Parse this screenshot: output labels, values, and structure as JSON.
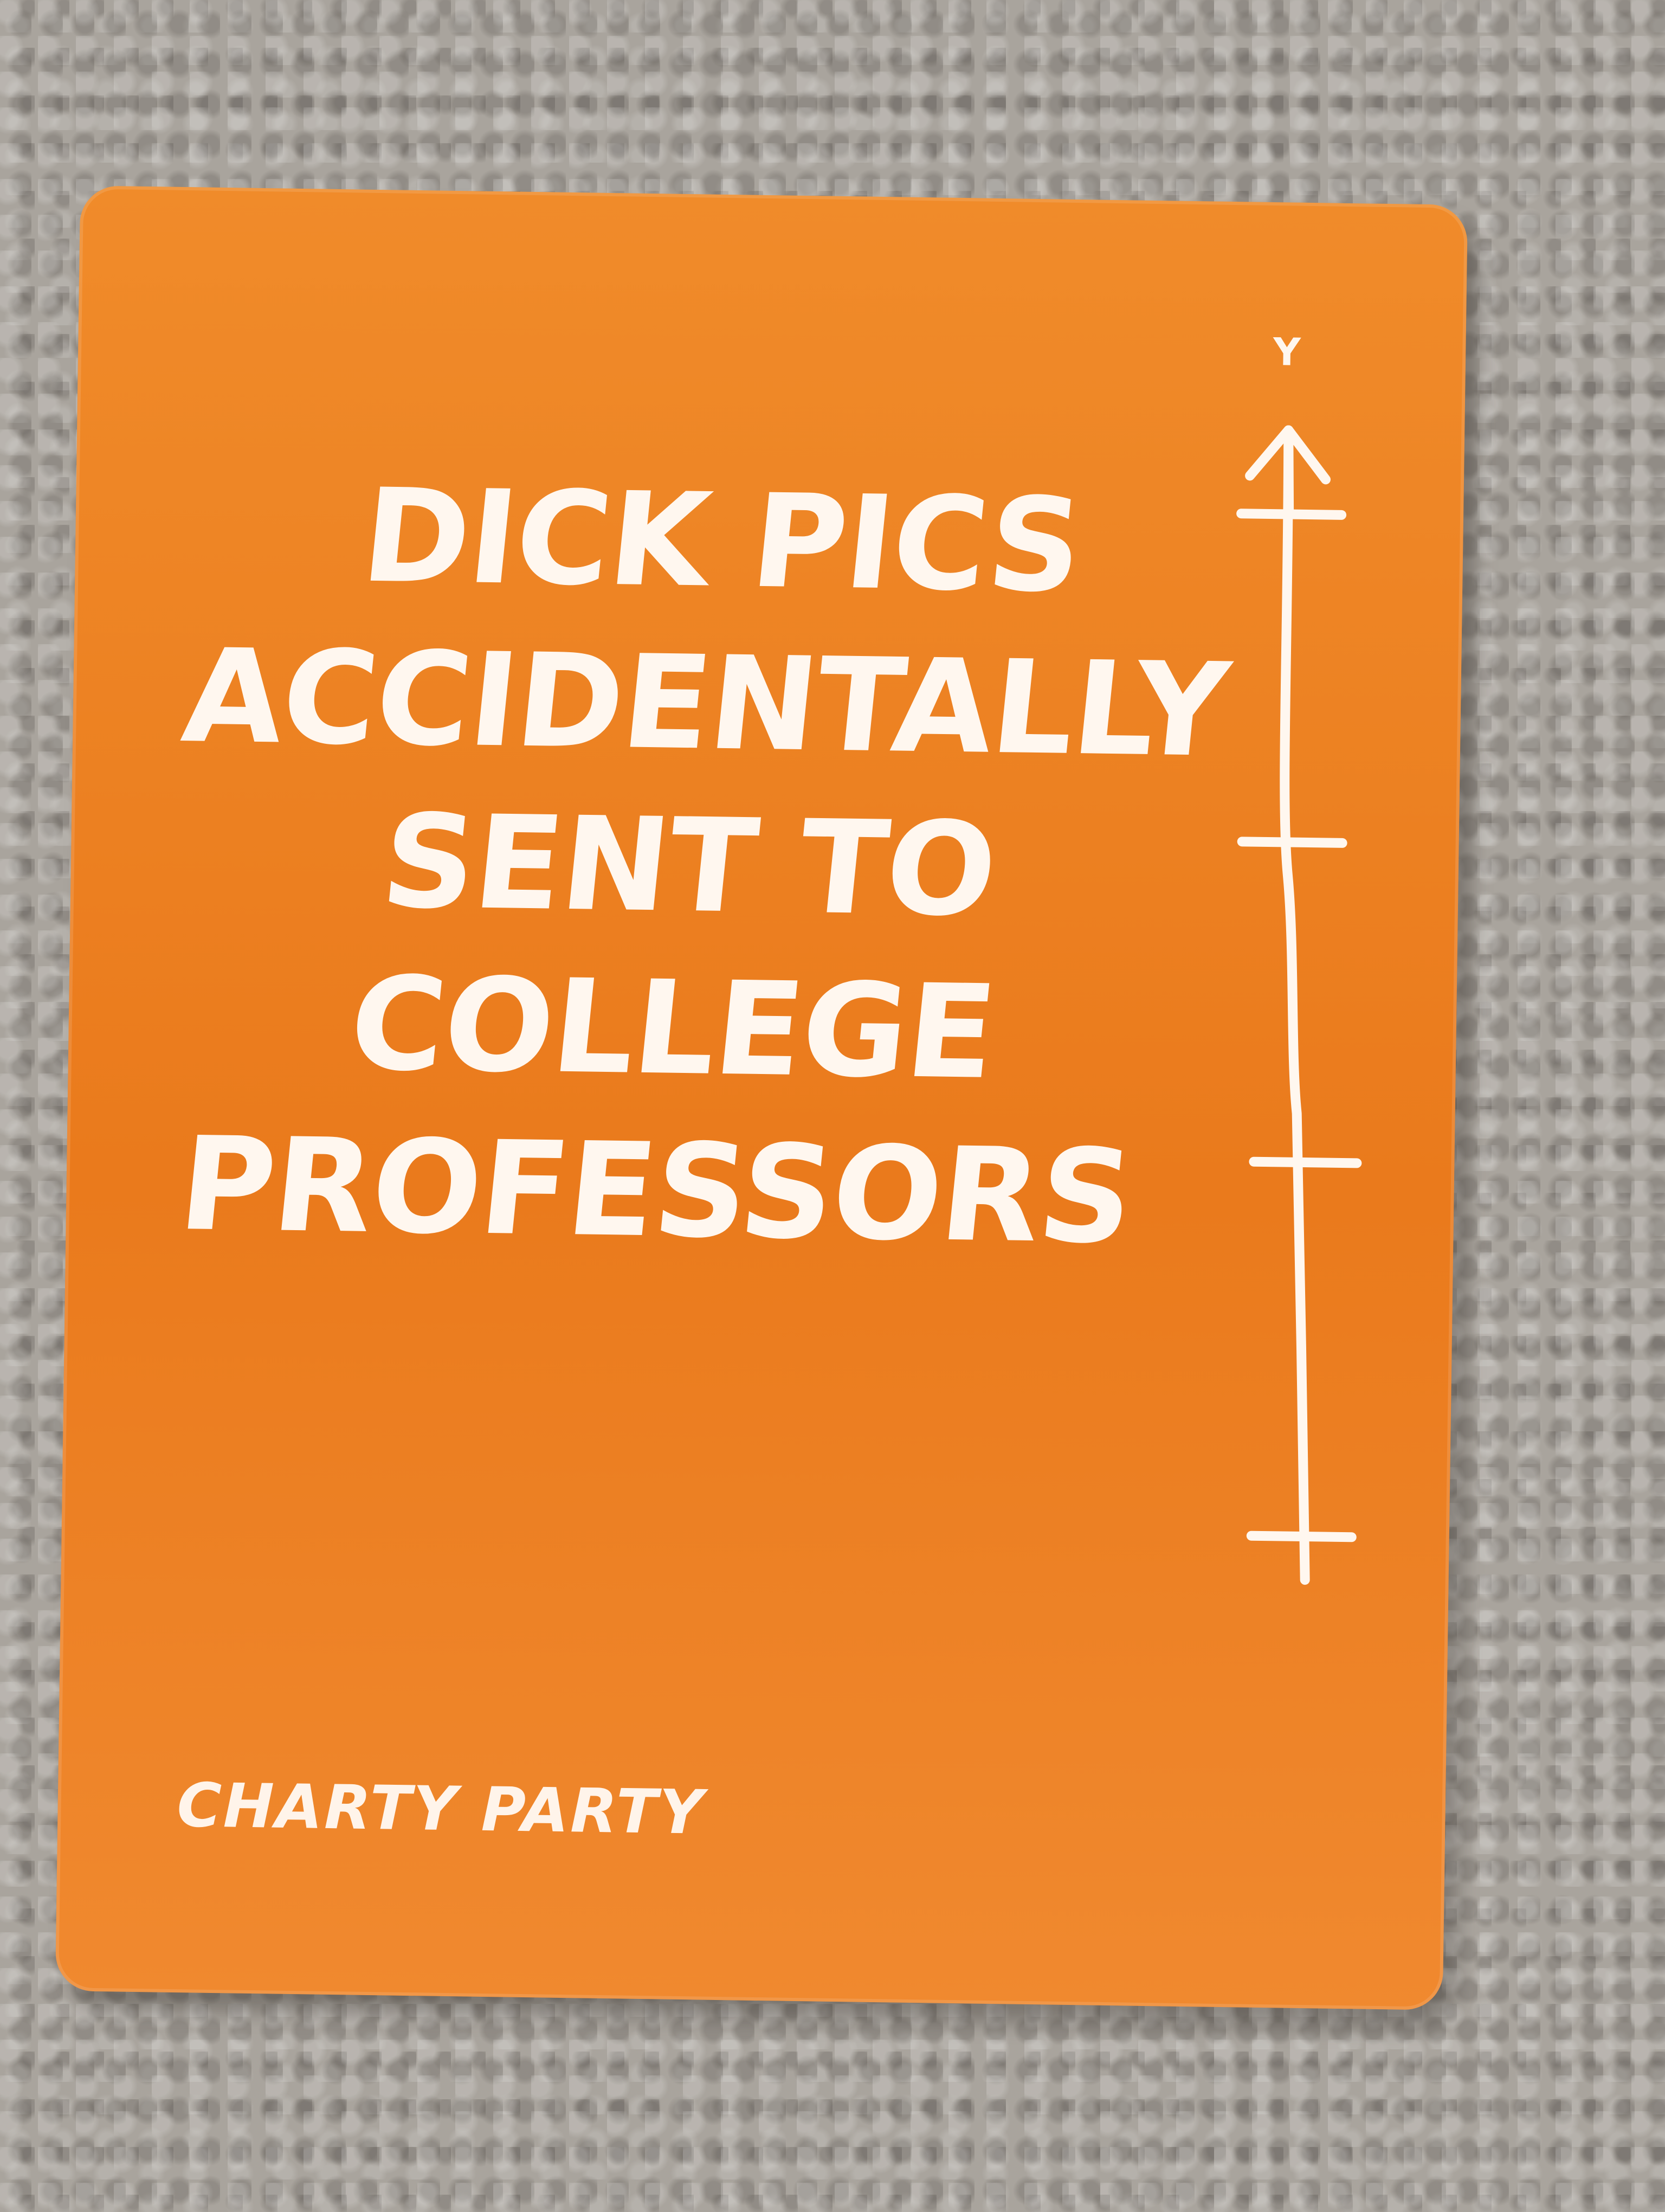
{
  "card": {
    "title_lines": [
      "DICK PICS",
      "ACCIDENTALLY",
      "SENT TO",
      "COLLEGE",
      "PROFESSORS"
    ],
    "brand": "CHARTY PARTY",
    "axis_label": "Y",
    "background_color": "#ea7a1c",
    "text_color": "#fff7ef"
  },
  "surface": {
    "description": "gray carpet",
    "color": "#a9a49d"
  }
}
